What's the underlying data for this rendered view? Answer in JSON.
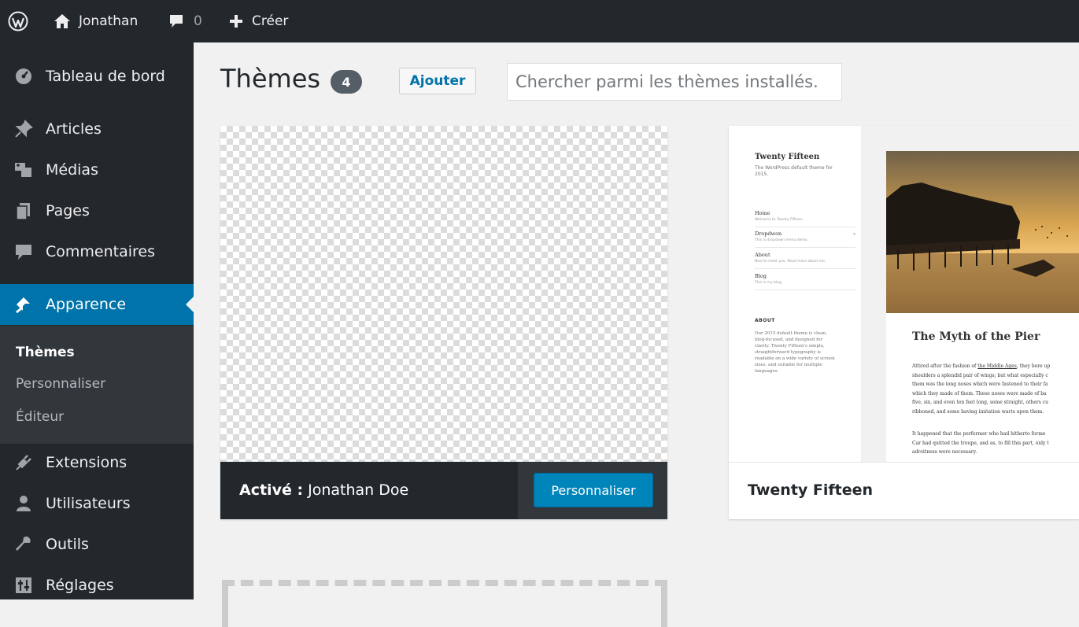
{
  "adminbar": {
    "site_name": "Jonathan",
    "comments_count": "0",
    "new_label": "Créer"
  },
  "sidebar": {
    "items": [
      {
        "label": "Tableau de bord",
        "icon": "dashboard-icon"
      },
      {
        "label": "Articles",
        "icon": "pin-icon"
      },
      {
        "label": "Médias",
        "icon": "media-icon"
      },
      {
        "label": "Pages",
        "icon": "pages-icon"
      },
      {
        "label": "Commentaires",
        "icon": "comment-icon"
      },
      {
        "label": "Apparence",
        "icon": "appearance-icon",
        "current": true
      },
      {
        "label": "Extensions",
        "icon": "plugin-icon"
      },
      {
        "label": "Utilisateurs",
        "icon": "users-icon"
      },
      {
        "label": "Outils",
        "icon": "tools-icon"
      },
      {
        "label": "Réglages",
        "icon": "settings-icon"
      }
    ],
    "submenu": [
      "Thèmes",
      "Personnaliser",
      "Éditeur"
    ]
  },
  "page": {
    "title": "Thèmes",
    "count": "4",
    "add_label": "Ajouter",
    "search_placeholder": "Chercher parmi les thèmes installés..."
  },
  "active_theme": {
    "prefix": "Activé :",
    "name": "Jonathan Doe",
    "customize_label": "Personnaliser"
  },
  "theme_card": {
    "name": "Twenty Fifteen",
    "preview": {
      "site_title": "Twenty Fifteen",
      "site_desc": "The WordPress default theme for 2015.",
      "nav": [
        {
          "label": "Home",
          "sub": "Welcome to Twenty Fifteen."
        },
        {
          "label": "Dropdwon",
          "sub": "This is dropdown menu demo."
        },
        {
          "label": "About",
          "sub": "Nice to meet you. Read more about me."
        },
        {
          "label": "Blog",
          "sub": "This is my blog."
        }
      ],
      "about_heading": "ABOUT",
      "about_text": "Our 2015 default theme is clean, blog-focused, and designed for clarity. Twenty Fifteen's simple, straightforward typography is readable on a wide variety of screen sizes, and suitable for multiple languages.",
      "post_title": "The Myth of the Pier",
      "para1_a": "Attired after the fashion of ",
      "para1_link": "the Middle Ages",
      "para1_b": ", they bore up\nshoulders a splendid pair of wings; but what especially c\nthem was the long noses which were fastened to their fa\nwhich they made of them. These noses were made of ba\nfive, six, and even ten feet long, some straight, others cu\nribboned, and some having imitation warts upon them.",
      "para2": "It happened that the performer who had hitherto forme\nCar had quitted the troupe, and as, to fill this part, only t\nadroitness were necessary."
    }
  }
}
